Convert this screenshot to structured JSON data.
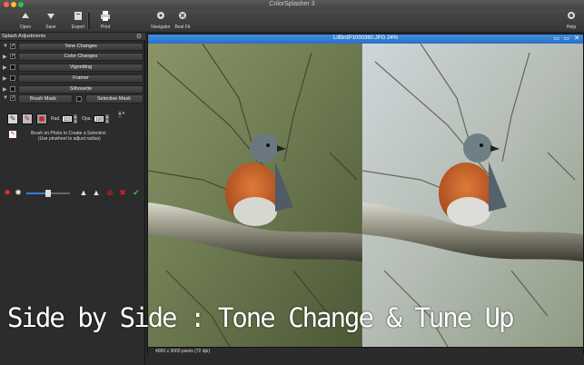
{
  "app": {
    "title": "ColorSplasher 3"
  },
  "toolbar": {
    "open": "Open",
    "save": "Save",
    "export": "Export",
    "print": "Print",
    "navigator": "Navigator",
    "best_fit": "Best Fit",
    "help": "Help"
  },
  "panel": {
    "title": "Splash Adjustments",
    "sections": [
      {
        "label": "Tone Changes",
        "checked": true
      },
      {
        "label": "Color Changes",
        "checked": true
      },
      {
        "label": "Vignetting",
        "checked": false
      },
      {
        "label": "Framer",
        "checked": false
      },
      {
        "label": "Silhouette",
        "checked": false
      }
    ],
    "brush_mask": "Brush Mask",
    "selective_mask": "Selective Mask",
    "rad_label": "Rad.",
    "rad_value": "115",
    "opa_label": "Opa.",
    "opa_value": "100",
    "info_line1": "Brush on Photo to Create a Selection",
    "info_line2": "(Use pinwheel to adjust radius)",
    "slider_value": 0.5
  },
  "image_window": {
    "title": "LilBirdP1000360.JPG 24%",
    "footer": "4000 x 3000 pixels (72 dpi)"
  },
  "caption": "Side by Side : Tone Change & Tune Up",
  "colors": {
    "accent_blue": "#2a6fc4",
    "red": "#d22020",
    "green": "#3cb83c"
  },
  "icons": [
    "open-icon",
    "save-icon",
    "export-icon",
    "print-icon",
    "navigator-icon",
    "best-fit-icon",
    "help-icon",
    "gear-icon",
    "brush-icon",
    "eraser-icon",
    "red-dot-icon",
    "white-dot-icon",
    "check-icon",
    "close-icon"
  ]
}
